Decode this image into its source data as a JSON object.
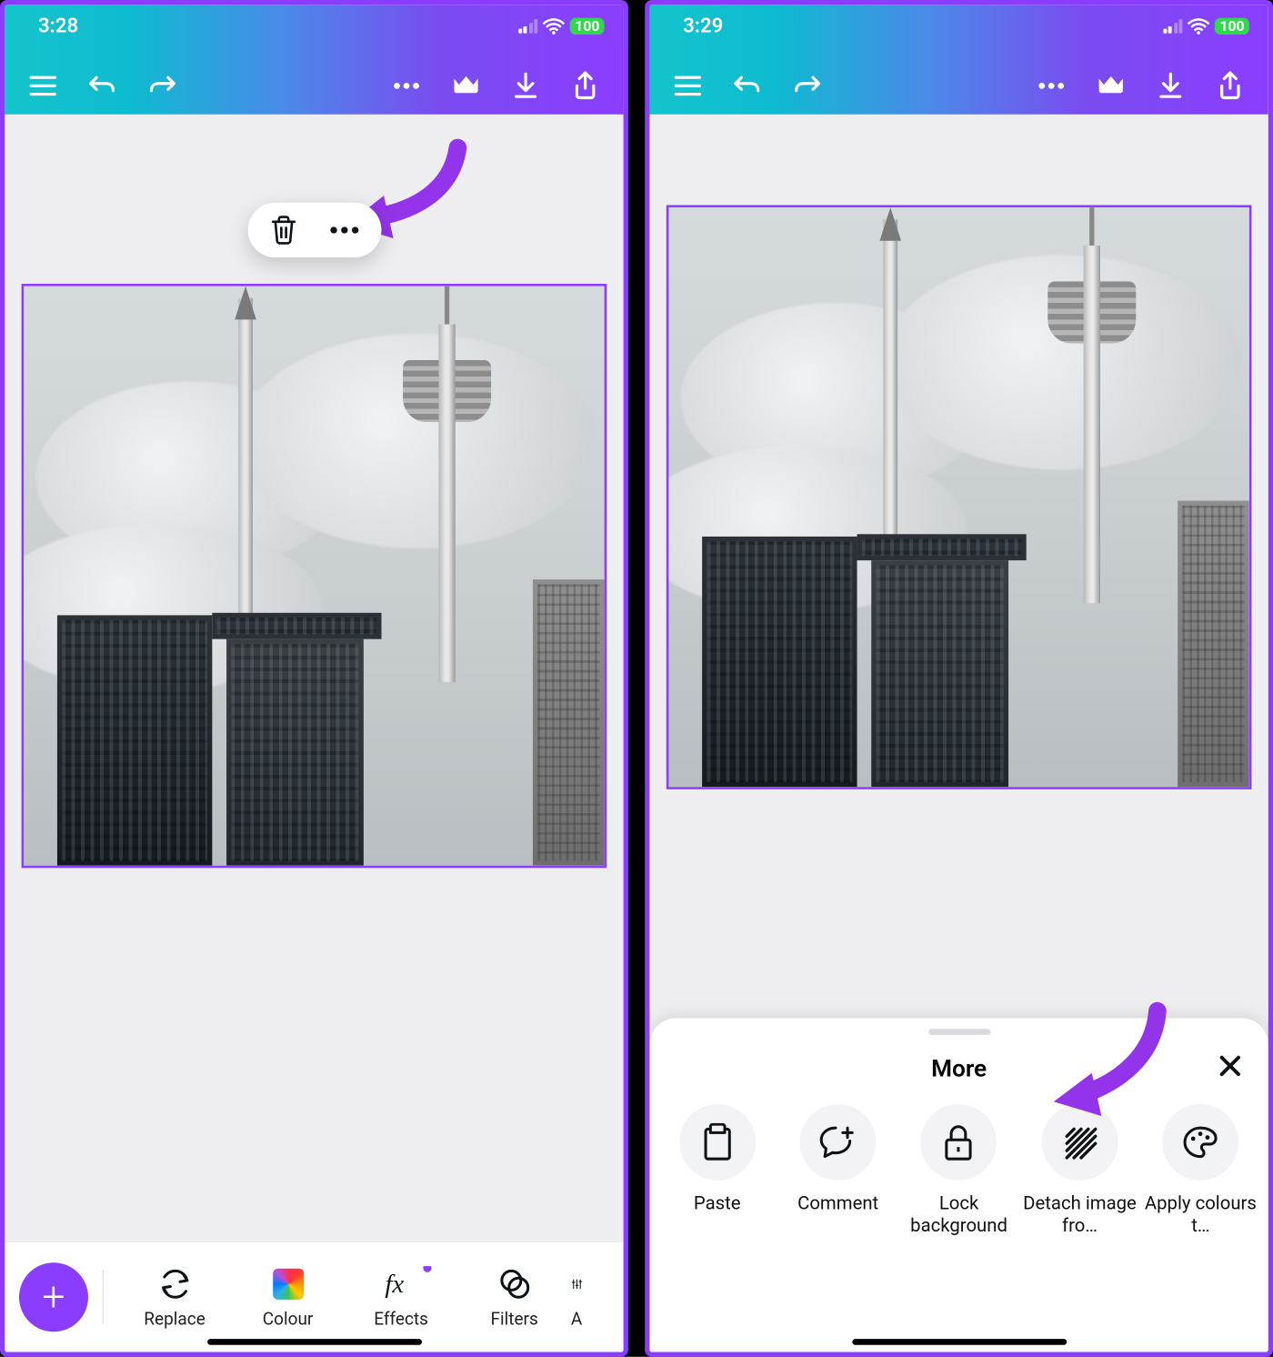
{
  "left": {
    "status": {
      "time": "3:28",
      "battery": "100"
    },
    "pill": {
      "delete": "trash-icon",
      "more": "more-icon"
    },
    "tools": [
      {
        "label": "Replace",
        "icon": "replace"
      },
      {
        "label": "Colour",
        "icon": "colour"
      },
      {
        "label": "Effects",
        "icon": "effects",
        "badge": true
      },
      {
        "label": "Filters",
        "icon": "filters"
      },
      {
        "label": "A",
        "icon": "adjust-partial"
      }
    ]
  },
  "right": {
    "status": {
      "time": "3:29",
      "battery": "100"
    },
    "sheet": {
      "title": "More",
      "items": [
        {
          "label": "Paste",
          "icon": "clipboard"
        },
        {
          "label": "Comment",
          "icon": "comment"
        },
        {
          "label": "Lock background",
          "icon": "lock"
        },
        {
          "label": "Detach image fro…",
          "icon": "hatch"
        },
        {
          "label": "Apply colours t…",
          "icon": "palette"
        }
      ]
    }
  }
}
